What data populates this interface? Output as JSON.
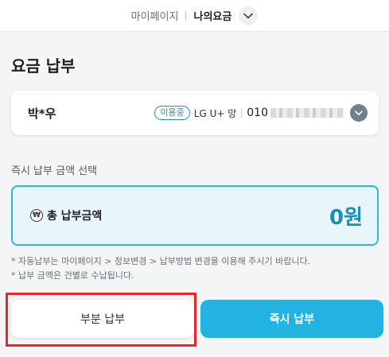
{
  "header": {
    "breadcrumb_parent": "마이페이지",
    "breadcrumb_current": "나의요금",
    "dropdown_icon": "chevron-down-icon"
  },
  "page": {
    "title": "요금 납부"
  },
  "account": {
    "name": "박*우",
    "status": "이용중",
    "carrier": "LG U+ 망",
    "phone_prefix": "010",
    "expand_icon": "chevron-down-icon",
    "expand_icon_color": "#6f7f8c"
  },
  "payment": {
    "section_label": "즉시 납부 금액 선택",
    "amount_icon": "won-icon",
    "amount_icon_glyph": "₩",
    "amount_label": "총 납부금액",
    "amount_value": "0원",
    "accent_color": "#2bb7df"
  },
  "notes": [
    "* 자동납부는 마이페이지 > 정보변경 > 납부방법 변경을 이용해 주시기 바랍니다.",
    "* 납부 금액은 건별로 수납됩니다."
  ],
  "actions": {
    "partial_label": "부분 납부",
    "instant_label": "즉시 납부",
    "instant_color": "#22b4e0",
    "highlight_color": "#e5262b"
  }
}
